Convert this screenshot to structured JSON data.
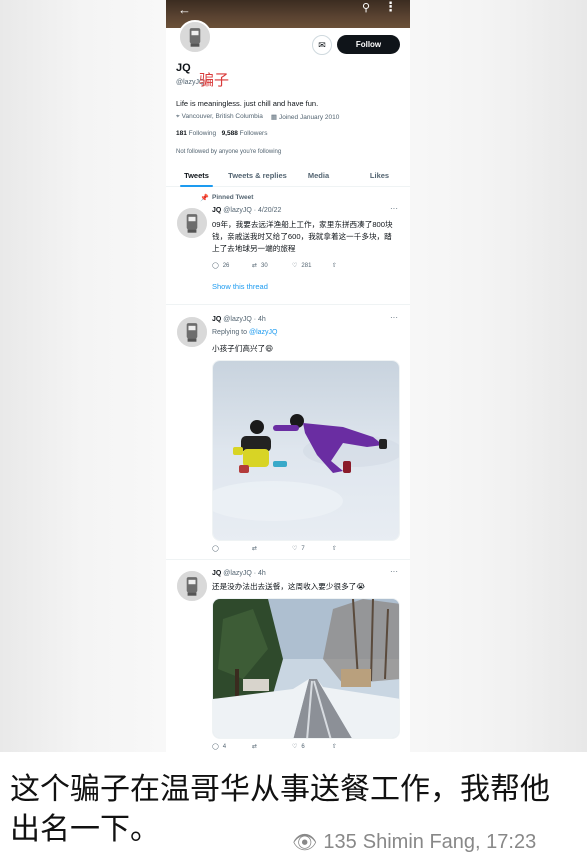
{
  "profile": {
    "name": "JQ",
    "handle": "@lazyJQ",
    "overlay_text": "骗子",
    "bio": "Life is meaningless. just chill and have fun.",
    "location": "Vancouver, British Columbia",
    "joined": "Joined January 2010",
    "following_count": "181",
    "following_label": "Following",
    "followers_count": "9,588",
    "followers_label": "Followers",
    "not_followed": "Not followed by anyone you're following",
    "follow_label": "Follow"
  },
  "tabs": [
    "Tweets",
    "Tweets & replies",
    "Media",
    "Likes"
  ],
  "tweets": [
    {
      "pinned_label": "Pinned Tweet",
      "name": "JQ",
      "meta": "@lazyJQ · 4/20/22",
      "text": "09年，我要去远洋渔船上工作，家里东拼西凑了800块钱，亲戚送我时又给了600，我就拿着这一千多块，踏上了去地球另一端的旅程",
      "replies": "26",
      "retweets": "30",
      "likes": "281",
      "show_thread": "Show this thread"
    },
    {
      "name": "JQ",
      "meta": "@lazyJQ · 4h",
      "replying_prefix": "Replying to",
      "replying_handle": "@lazyJQ",
      "text": "小孩子们高兴了😄",
      "replies": "",
      "retweets": "",
      "likes": "7"
    },
    {
      "name": "JQ",
      "meta": "@lazyJQ · 4h",
      "text": "还是没办法出去送餐，这周收入要少很多了😭",
      "replies": "4",
      "retweets": "",
      "likes": "6"
    }
  ],
  "caption": {
    "text": "这个骗子在温哥华从事送餐工作，我帮他出名一下。",
    "views": "135",
    "author_time": "Shimin Fang, 17:23"
  },
  "colors": {
    "accent": "#1d9bf0",
    "overlay_red": "#d93a3a",
    "follow_bg": "#0f1419"
  }
}
